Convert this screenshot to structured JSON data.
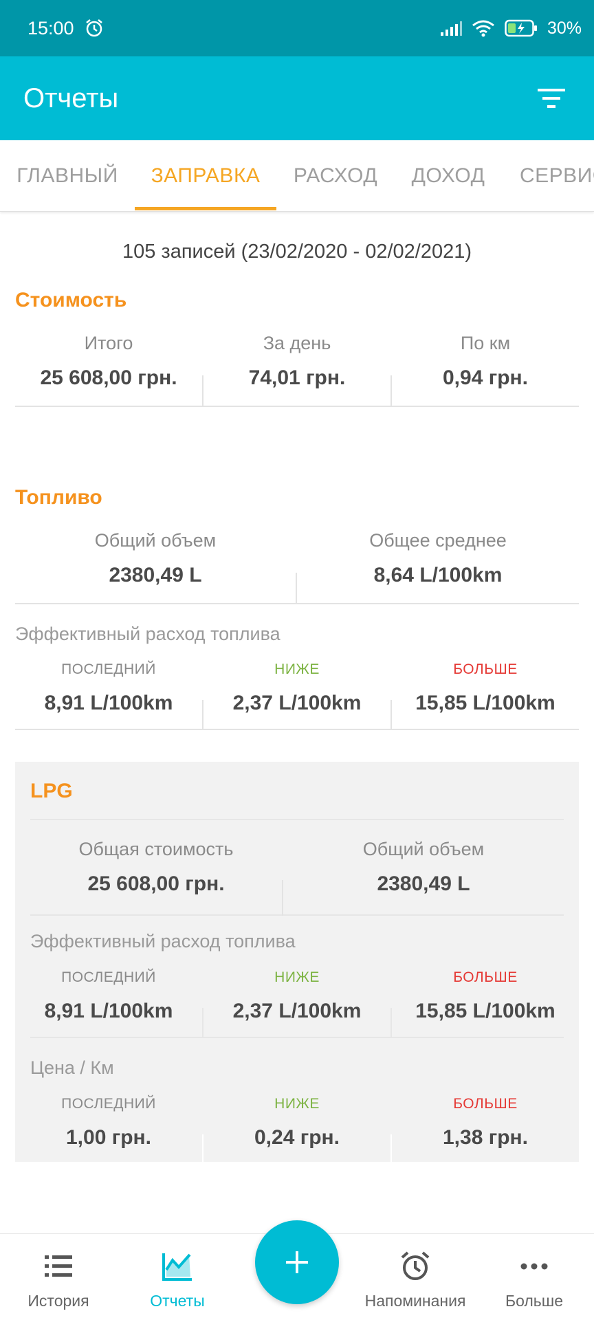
{
  "status_bar": {
    "time": "15:00",
    "battery": "30%"
  },
  "app_bar": {
    "title": "Отчеты"
  },
  "tabs": [
    {
      "label": "ГЛАВНЫЙ",
      "active": false
    },
    {
      "label": "ЗАПРАВКА",
      "active": true
    },
    {
      "label": "РАСХОД",
      "active": false
    },
    {
      "label": "ДОХОД",
      "active": false
    },
    {
      "label": "СЕРВИС",
      "active": false
    }
  ],
  "records_summary": "105 записей (23/02/2020 - 02/02/2021)",
  "cost": {
    "title": "Стоимость",
    "total_label": "Итого",
    "total_value": "25 608,00 грн.",
    "per_day_label": "За день",
    "per_day_value": "74,01 грн.",
    "per_km_label": "По км",
    "per_km_value": "0,94 грн."
  },
  "fuel": {
    "title": "Топливо",
    "volume_label": "Общий объем",
    "volume_value": "2380,49 L",
    "avg_label": "Общее среднее",
    "avg_value": "8,64 L/100km",
    "efficiency_title": "Эффективный расход топлива",
    "last_label": "ПОСЛЕДНИЙ",
    "last_value": "8,91 L/100km",
    "low_label": "НИЖЕ",
    "low_value": "2,37 L/100km",
    "high_label": "БОЛЬШЕ",
    "high_value": "15,85 L/100km"
  },
  "lpg": {
    "title": "LPG",
    "cost_label": "Общая стоимость",
    "cost_value": "25 608,00 грн.",
    "volume_label": "Общий объем",
    "volume_value": "2380,49 L",
    "efficiency_title": "Эффективный расход топлива",
    "eff_last_label": "ПОСЛЕДНИЙ",
    "eff_last_value": "8,91 L/100km",
    "eff_low_label": "НИЖЕ",
    "eff_low_value": "2,37 L/100km",
    "eff_high_label": "БОЛЬШЕ",
    "eff_high_value": "15,85 L/100km",
    "price_title": "Цена / Км",
    "price_last_label": "ПОСЛЕДНИЙ",
    "price_last_value": "1,00 грн.",
    "price_low_label": "НИЖЕ",
    "price_low_value": "0,24 грн.",
    "price_high_label": "БОЛЬШЕ",
    "price_high_value": "1,38 грн."
  },
  "bottom_nav": [
    {
      "label": "История",
      "icon": "list-icon"
    },
    {
      "label": "Отчеты",
      "icon": "chart-icon",
      "active": true
    },
    {
      "label": "Напоминания",
      "icon": "alarm-icon"
    },
    {
      "label": "Больше",
      "icon": "more-icon"
    }
  ],
  "colors": {
    "primary": "#00BCD4",
    "status_bar": "#0096A8",
    "accent": "#F5921E",
    "low": "#7CB342",
    "high": "#E53935"
  }
}
